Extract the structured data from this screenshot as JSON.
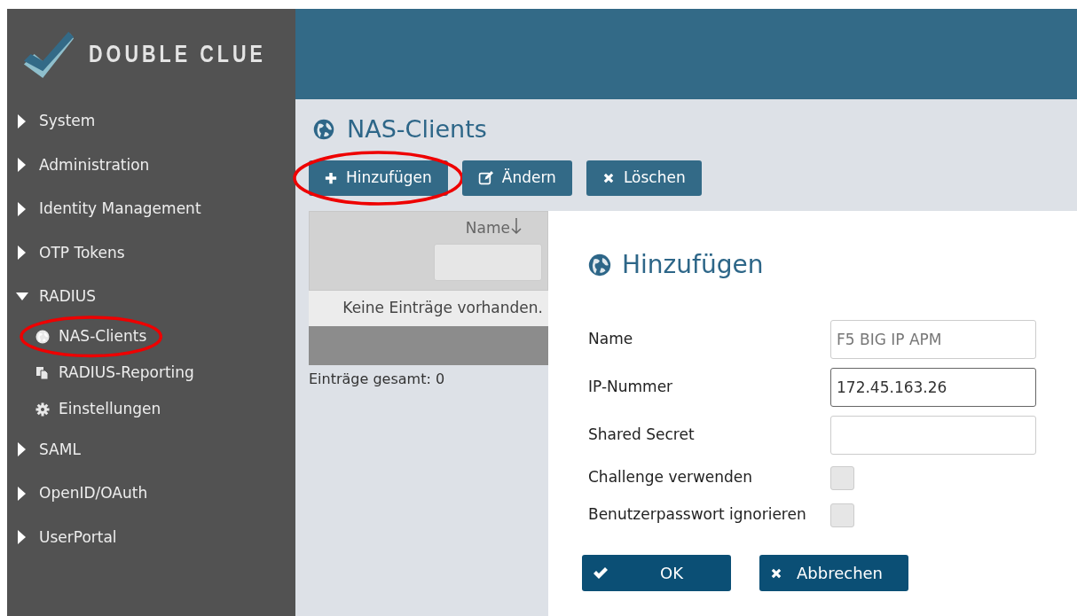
{
  "logo": {
    "text": "DOUBLE CLUE"
  },
  "sidebar": {
    "items": [
      {
        "label": "System",
        "expanded": false
      },
      {
        "label": "Administration",
        "expanded": false
      },
      {
        "label": "Identity Management",
        "expanded": false
      },
      {
        "label": "OTP Tokens",
        "expanded": false
      },
      {
        "label": "RADIUS",
        "expanded": true,
        "children": [
          {
            "label": "NAS-Clients",
            "kind": "globe",
            "circled": true
          },
          {
            "label": "RADIUS-Reporting",
            "kind": "copy",
            "circled": false
          },
          {
            "label": "Einstellungen",
            "kind": "gear",
            "circled": false
          }
        ]
      },
      {
        "label": "SAML",
        "expanded": false
      },
      {
        "label": "OpenID/OAuth",
        "expanded": false
      },
      {
        "label": "UserPortal",
        "expanded": false
      }
    ]
  },
  "page": {
    "title": "NAS-Clients",
    "toolbar": [
      {
        "label": "Hinzufügen",
        "kind": "plus",
        "circled": true
      },
      {
        "label": "Ändern",
        "kind": "edit",
        "circled": false
      },
      {
        "label": "Löschen",
        "kind": "times",
        "circled": false
      }
    ],
    "table": {
      "columns": [
        {
          "label": "Name",
          "sorted": true
        }
      ],
      "empty_text": "Keine Einträge vorhanden.",
      "total": "Einträge gesamt: 0"
    }
  },
  "dialog": {
    "title": "Hinzufügen",
    "fields": [
      {
        "label": "Name",
        "kind": "text",
        "placeholder": "F5 BIG IP APM",
        "focused": false
      },
      {
        "label": "IP-Nummer",
        "kind": "text",
        "value": "172.45.163.26",
        "focused": true
      },
      {
        "label": "Shared Secret",
        "kind": "text",
        "focused": false
      },
      {
        "label": "Challenge verwenden",
        "kind": "checkbox",
        "checked": false
      },
      {
        "label": "Benutzerpasswort ignorieren",
        "kind": "checkbox",
        "checked": false
      }
    ],
    "buttons": [
      {
        "label": "OK",
        "kind": "check"
      },
      {
        "label": "Abbrechen",
        "kind": "times"
      }
    ]
  }
}
